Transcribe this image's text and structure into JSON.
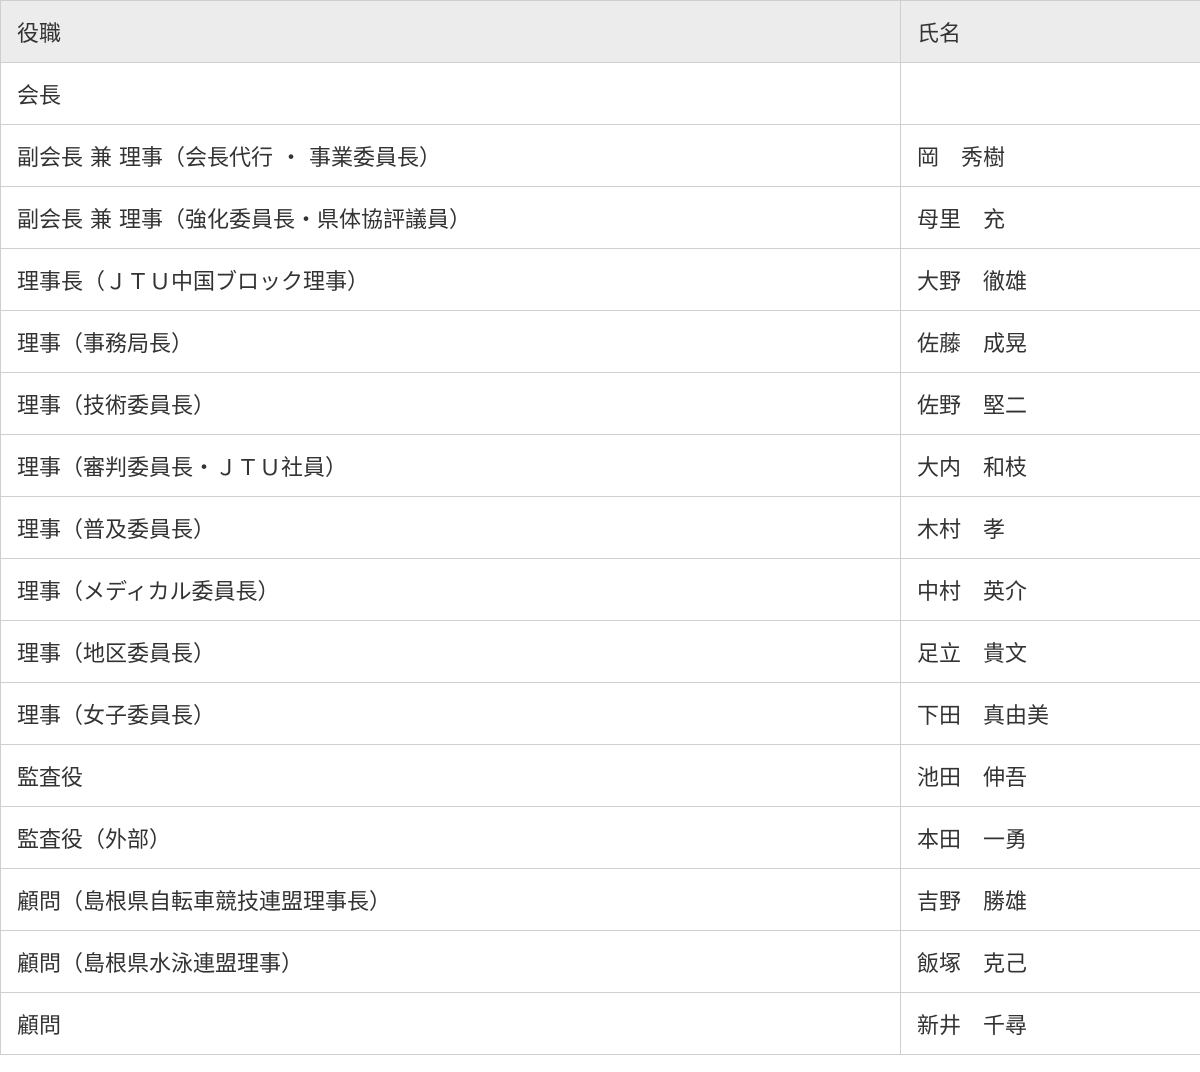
{
  "table": {
    "headers": {
      "role": "役職",
      "name": "氏名"
    },
    "rows": [
      {
        "role": "会長",
        "name": ""
      },
      {
        "role": "副会長 兼 理事（会長代行 ・ 事業委員長）",
        "name": "岡　秀樹"
      },
      {
        "role": "副会長 兼 理事（強化委員長・県体協評議員）",
        "name": "母里　充"
      },
      {
        "role": "理事長（ＪＴＵ中国ブロック理事）",
        "name": "大野　徹雄"
      },
      {
        "role": "理事（事務局長）",
        "name": "佐藤　成晃"
      },
      {
        "role": "理事（技術委員長）",
        "name": "佐野　堅二"
      },
      {
        "role": "理事（審判委員長・ＪＴＵ社員）",
        "name": "大内　和枝"
      },
      {
        "role": "理事（普及委員長）",
        "name": "木村　孝"
      },
      {
        "role": "理事（メディカル委員長）",
        "name": "中村　英介"
      },
      {
        "role": "理事（地区委員長）",
        "name": "足立　貴文"
      },
      {
        "role": "理事（女子委員長）",
        "name": "下田　真由美"
      },
      {
        "role": "監査役",
        "name": "池田　伸吾"
      },
      {
        "role": "監査役（外部）",
        "name": "本田　一勇"
      },
      {
        "role": "顧問（島根県自転車競技連盟理事長）",
        "name": "吉野　勝雄"
      },
      {
        "role": "顧問（島根県水泳連盟理事）",
        "name": "飯塚　克己"
      },
      {
        "role": "顧問",
        "name": "新井　千尋"
      }
    ]
  }
}
